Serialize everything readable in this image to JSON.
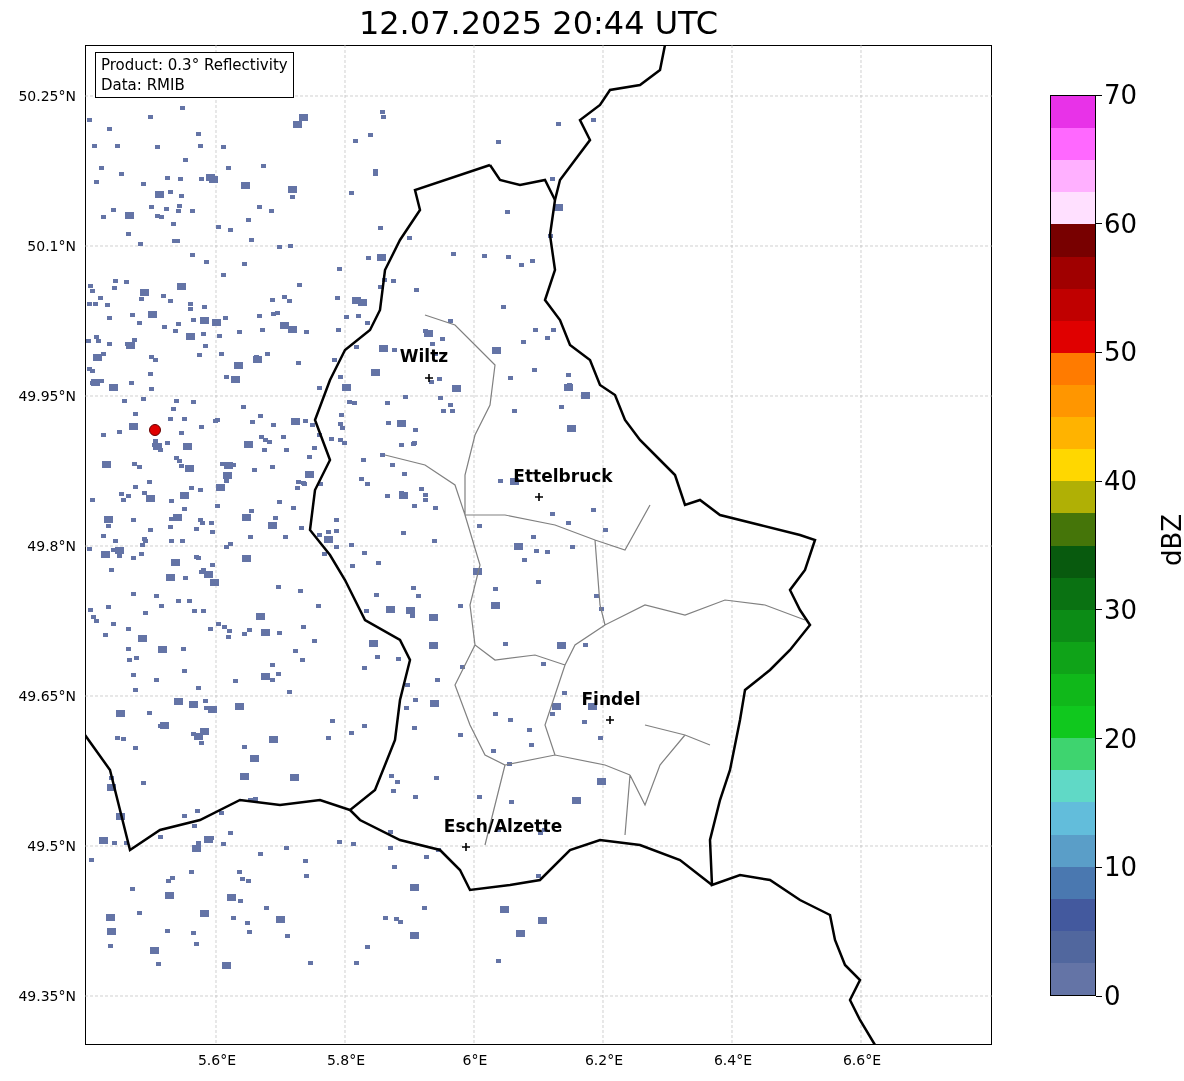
{
  "title": "12.07.2025 20:44 UTC",
  "info_box": [
    "Product: 0.3° Reflectivity",
    "Data: RMIB"
  ],
  "lat_labels": [
    "50.25°N",
    "50.1°N",
    "49.95°N",
    "49.8°N",
    "49.65°N",
    "49.5°N",
    "49.35°N"
  ],
  "lon_labels": [
    "5.6°E",
    "5.8°E",
    "6°E",
    "6.2°E",
    "6.4°E",
    "6.6°E"
  ],
  "cities": [
    {
      "name": "Wiltz"
    },
    {
      "name": "Ettelbruck"
    },
    {
      "name": "Findel"
    },
    {
      "name": "Esch/Alzette"
    }
  ],
  "colorbar": {
    "label": "dBZ",
    "ticks": [
      "70",
      "60",
      "50",
      "40",
      "30",
      "20",
      "10",
      "0"
    ],
    "bands": [
      {
        "color": "#e832e8"
      },
      {
        "color": "#ff68ff"
      },
      {
        "color": "#ffb0ff"
      },
      {
        "color": "#ffe0ff"
      },
      {
        "color": "#780000"
      },
      {
        "color": "#a00000"
      },
      {
        "color": "#c00000"
      },
      {
        "color": "#e00000"
      },
      {
        "color": "#ff7b00"
      },
      {
        "color": "#ff9600"
      },
      {
        "color": "#ffb300"
      },
      {
        "color": "#ffd700"
      },
      {
        "color": "#b0b005"
      },
      {
        "color": "#457509"
      },
      {
        "color": "#085a0e"
      },
      {
        "color": "#0a7212"
      },
      {
        "color": "#0c8c16"
      },
      {
        "color": "#0fa318"
      },
      {
        "color": "#10b81a"
      },
      {
        "color": "#10c81e"
      },
      {
        "color": "#3ed46f"
      },
      {
        "color": "#60d9c6"
      },
      {
        "color": "#62bddb"
      },
      {
        "color": "#5a9ec8"
      },
      {
        "color": "#4a78b0"
      },
      {
        "color": "#43599e"
      },
      {
        "color": "#51679e"
      },
      {
        "color": "#6474a6"
      }
    ]
  }
}
